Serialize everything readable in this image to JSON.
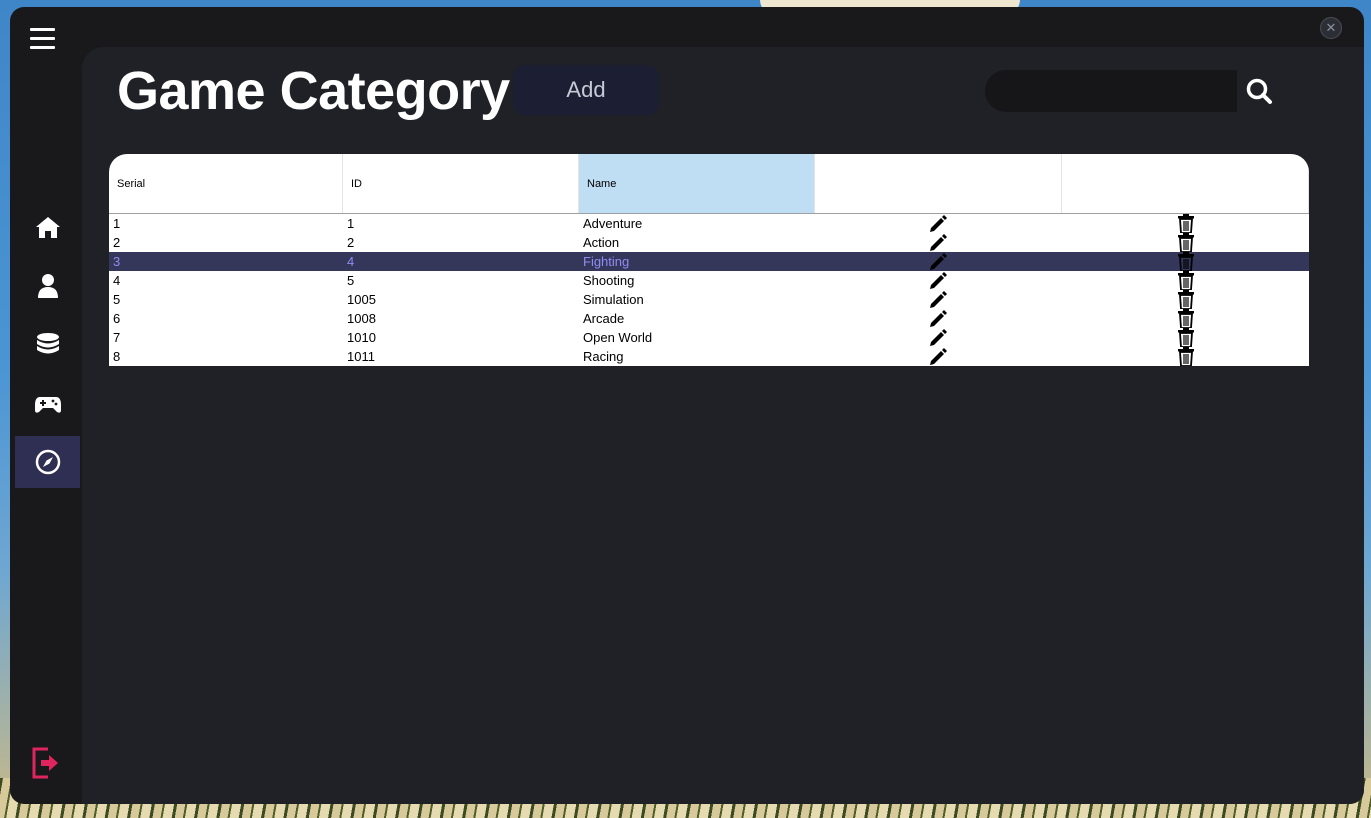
{
  "window": {
    "close_glyph": "✕"
  },
  "sidebar": {
    "menu_icon": "hamburger-icon",
    "items": [
      {
        "name": "home",
        "icon": "home-icon",
        "active": false
      },
      {
        "name": "user",
        "icon": "user-icon",
        "active": false
      },
      {
        "name": "database",
        "icon": "database-icon",
        "active": false
      },
      {
        "name": "games",
        "icon": "gamepad-icon",
        "active": false
      },
      {
        "name": "category",
        "icon": "compass-icon",
        "active": true
      }
    ],
    "exit_icon": "logout-icon",
    "active_color": "#2e2f52",
    "exit_color": "#e0245e"
  },
  "header": {
    "title": "Game Category",
    "add_label": "Add",
    "search_value": "",
    "search_icon": "search-icon"
  },
  "table": {
    "columns": [
      "Serial",
      "ID",
      "Name",
      "",
      ""
    ],
    "selected_column": 2,
    "selected_row": 2,
    "edit_icon": "pencil-icon",
    "delete_icon": "trash-icon",
    "rows": [
      {
        "serial": "1",
        "id": "1",
        "name": "Adventure"
      },
      {
        "serial": "2",
        "id": "2",
        "name": "Action"
      },
      {
        "serial": "3",
        "id": "4",
        "name": "Fighting"
      },
      {
        "serial": "4",
        "id": "5",
        "name": "Shooting"
      },
      {
        "serial": "5",
        "id": "1005",
        "name": "Simulation"
      },
      {
        "serial": "6",
        "id": "1008",
        "name": "Arcade"
      },
      {
        "serial": "7",
        "id": "1010",
        "name": "Open World"
      },
      {
        "serial": "8",
        "id": "1011",
        "name": "Racing"
      }
    ]
  }
}
